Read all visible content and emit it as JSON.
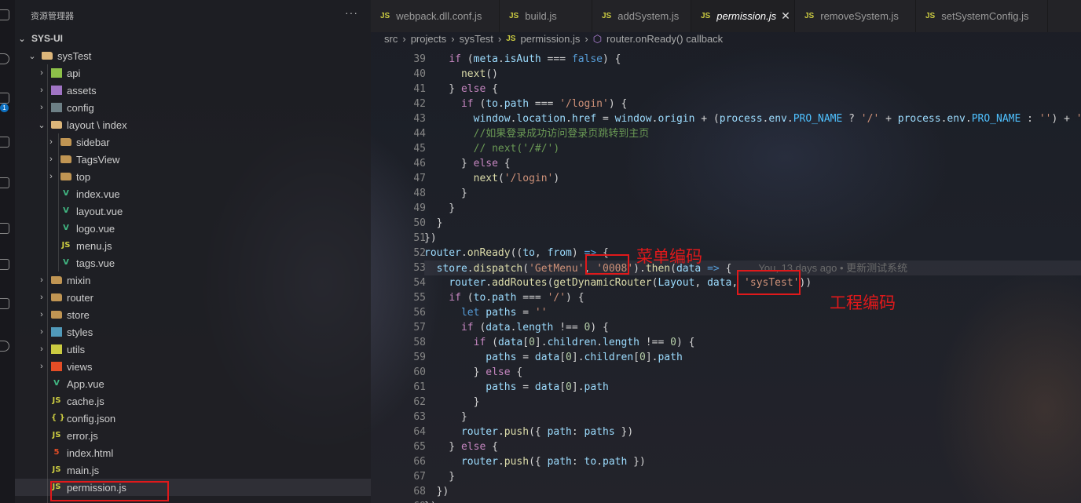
{
  "explorer": {
    "title": "资源管理器",
    "more": "···",
    "root": "SYS-UI",
    "tree": [
      {
        "label": "sysTest",
        "kind": "folder-open",
        "depth": 1,
        "chev": "⌄"
      },
      {
        "label": "api",
        "kind": "api",
        "depth": 2,
        "chev": "›"
      },
      {
        "label": "assets",
        "kind": "assets",
        "depth": 2,
        "chev": "›"
      },
      {
        "label": "config",
        "kind": "config",
        "depth": 2,
        "chev": "›"
      },
      {
        "label": "layout \\ index",
        "kind": "folder-open",
        "depth": 2,
        "chev": "⌄"
      },
      {
        "label": "sidebar",
        "kind": "folder",
        "depth": 3,
        "chev": "›"
      },
      {
        "label": "TagsView",
        "kind": "folder",
        "depth": 3,
        "chev": "›"
      },
      {
        "label": "top",
        "kind": "folder",
        "depth": 3,
        "chev": "›"
      },
      {
        "label": "index.vue",
        "kind": "vue",
        "depth": 3,
        "chev": ""
      },
      {
        "label": "layout.vue",
        "kind": "vue",
        "depth": 3,
        "chev": ""
      },
      {
        "label": "logo.vue",
        "kind": "vue",
        "depth": 3,
        "chev": ""
      },
      {
        "label": "menu.js",
        "kind": "js",
        "depth": 3,
        "chev": ""
      },
      {
        "label": "tags.vue",
        "kind": "vue",
        "depth": 3,
        "chev": ""
      },
      {
        "label": "mixin",
        "kind": "folder",
        "depth": 2,
        "chev": "›"
      },
      {
        "label": "router",
        "kind": "folder",
        "depth": 2,
        "chev": "›"
      },
      {
        "label": "store",
        "kind": "folder",
        "depth": 2,
        "chev": "›"
      },
      {
        "label": "styles",
        "kind": "styles",
        "depth": 2,
        "chev": "›"
      },
      {
        "label": "utils",
        "kind": "utils",
        "depth": 2,
        "chev": "›"
      },
      {
        "label": "views",
        "kind": "views",
        "depth": 2,
        "chev": "›"
      },
      {
        "label": "App.vue",
        "kind": "vue",
        "depth": 2,
        "chev": ""
      },
      {
        "label": "cache.js",
        "kind": "js",
        "depth": 2,
        "chev": ""
      },
      {
        "label": "config.json",
        "kind": "json",
        "depth": 2,
        "chev": ""
      },
      {
        "label": "error.js",
        "kind": "js",
        "depth": 2,
        "chev": ""
      },
      {
        "label": "index.html",
        "kind": "html",
        "depth": 2,
        "chev": ""
      },
      {
        "label": "main.js",
        "kind": "js",
        "depth": 2,
        "chev": ""
      },
      {
        "label": "permission.js",
        "kind": "js",
        "depth": 2,
        "chev": "",
        "selected": true
      }
    ]
  },
  "tabs": [
    {
      "label": "webpack.dll.conf.js",
      "active": false
    },
    {
      "label": "build.js",
      "active": false
    },
    {
      "label": "addSystem.js",
      "active": false
    },
    {
      "label": "permission.js",
      "active": true
    },
    {
      "label": "removeSystem.js",
      "active": false
    },
    {
      "label": "setSystemConfig.js",
      "active": false
    }
  ],
  "breadcrumb": {
    "parts": [
      "src",
      "projects",
      "sysTest"
    ],
    "file": "permission.js",
    "symbol": "router.onReady() callback"
  },
  "code": {
    "first_line": 39,
    "highlight_line": 53,
    "blame": "You, 13 days ago • 更新测试系统",
    "lines": [
      [
        [
          "    ",
          ""
        ],
        [
          "if",
          "kw"
        ],
        [
          " (",
          ""
        ],
        [
          "meta",
          "v"
        ],
        [
          ".",
          ""
        ],
        [
          "isAuth",
          "v"
        ],
        [
          " === ",
          ""
        ],
        [
          "false",
          "k2"
        ],
        [
          ") {",
          ""
        ]
      ],
      [
        [
          "      ",
          ""
        ],
        [
          "next",
          "f"
        ],
        [
          "()",
          ""
        ]
      ],
      [
        [
          "    } ",
          ""
        ],
        [
          "else",
          "kw"
        ],
        [
          " {",
          ""
        ]
      ],
      [
        [
          "      ",
          ""
        ],
        [
          "if",
          "kw"
        ],
        [
          " (",
          ""
        ],
        [
          "to",
          "v"
        ],
        [
          ".",
          ""
        ],
        [
          "path",
          "v"
        ],
        [
          " === ",
          ""
        ],
        [
          "'/login'",
          "s"
        ],
        [
          ") {",
          ""
        ]
      ],
      [
        [
          "        ",
          ""
        ],
        [
          "window",
          "v"
        ],
        [
          ".",
          ""
        ],
        [
          "location",
          "v"
        ],
        [
          ".",
          ""
        ],
        [
          "href",
          "v"
        ],
        [
          " = ",
          ""
        ],
        [
          "window",
          "v"
        ],
        [
          ".",
          ""
        ],
        [
          "origin",
          "v"
        ],
        [
          " + (",
          ""
        ],
        [
          "process",
          "v"
        ],
        [
          ".",
          ""
        ],
        [
          "env",
          "v"
        ],
        [
          ".",
          ""
        ],
        [
          "PRO_NAME",
          "cst"
        ],
        [
          " ? ",
          ""
        ],
        [
          "'/'",
          "s"
        ],
        [
          " + ",
          ""
        ],
        [
          "process",
          "v"
        ],
        [
          ".",
          ""
        ],
        [
          "env",
          "v"
        ],
        [
          ".",
          ""
        ],
        [
          "PRO_NAME",
          "cst"
        ],
        [
          " : ",
          ""
        ],
        [
          "''",
          "s"
        ],
        [
          ") + ",
          ""
        ],
        [
          "'/#/login'",
          "s"
        ]
      ],
      [
        [
          "        ",
          ""
        ],
        [
          "//如果登录成功访问登录页跳转到主页",
          "c"
        ]
      ],
      [
        [
          "        ",
          ""
        ],
        [
          "// next('/#/')",
          "c"
        ]
      ],
      [
        [
          "      } ",
          ""
        ],
        [
          "else",
          "kw"
        ],
        [
          " {",
          ""
        ]
      ],
      [
        [
          "        ",
          ""
        ],
        [
          "next",
          "f"
        ],
        [
          "(",
          ""
        ],
        [
          "'/login'",
          "s"
        ],
        [
          ")",
          ""
        ]
      ],
      [
        [
          "      }",
          ""
        ]
      ],
      [
        [
          "    }",
          ""
        ]
      ],
      [
        [
          "  }",
          ""
        ]
      ],
      [
        [
          "})",
          ""
        ]
      ],
      [
        [
          "router",
          "v"
        ],
        [
          ".",
          ""
        ],
        [
          "onReady",
          "f"
        ],
        [
          "((",
          ""
        ],
        [
          "to",
          "v"
        ],
        [
          ", ",
          ""
        ],
        [
          "from",
          "v"
        ],
        [
          ") ",
          ""
        ],
        [
          "=>",
          "k2"
        ],
        [
          " {",
          ""
        ]
      ],
      [
        [
          "  ",
          ""
        ],
        [
          "store",
          "v"
        ],
        [
          ".",
          ""
        ],
        [
          "dispatch",
          "f"
        ],
        [
          "(",
          ""
        ],
        [
          "'GetMenu'",
          "s"
        ],
        [
          ", ",
          ""
        ],
        [
          "'0008'",
          "s"
        ],
        [
          ").",
          ""
        ],
        [
          "then",
          "f"
        ],
        [
          "(",
          ""
        ],
        [
          "data",
          "v"
        ],
        [
          " ",
          ""
        ],
        [
          "=>",
          "k2"
        ],
        [
          " {",
          ""
        ]
      ],
      [
        [
          "    ",
          ""
        ],
        [
          "router",
          "v"
        ],
        [
          ".",
          ""
        ],
        [
          "addRoutes",
          "f"
        ],
        [
          "(",
          ""
        ],
        [
          "getDynamicRouter",
          "f"
        ],
        [
          "(",
          ""
        ],
        [
          "Layout",
          "v"
        ],
        [
          ", ",
          ""
        ],
        [
          "data",
          "v"
        ],
        [
          ", ",
          ""
        ],
        [
          "'sysTest'",
          "s"
        ],
        [
          "))",
          ""
        ]
      ],
      [
        [
          "    ",
          ""
        ],
        [
          "if",
          "kw"
        ],
        [
          " (",
          ""
        ],
        [
          "to",
          "v"
        ],
        [
          ".",
          ""
        ],
        [
          "path",
          "v"
        ],
        [
          " === ",
          ""
        ],
        [
          "'/'",
          "s"
        ],
        [
          ") {",
          ""
        ]
      ],
      [
        [
          "      ",
          ""
        ],
        [
          "let",
          "k2"
        ],
        [
          " ",
          ""
        ],
        [
          "paths",
          "v"
        ],
        [
          " = ",
          ""
        ],
        [
          "''",
          "s"
        ]
      ],
      [
        [
          "      ",
          ""
        ],
        [
          "if",
          "kw"
        ],
        [
          " (",
          ""
        ],
        [
          "data",
          "v"
        ],
        [
          ".",
          ""
        ],
        [
          "length",
          "v"
        ],
        [
          " !== ",
          ""
        ],
        [
          "0",
          "n"
        ],
        [
          ") {",
          ""
        ]
      ],
      [
        [
          "        ",
          ""
        ],
        [
          "if",
          "kw"
        ],
        [
          " (",
          ""
        ],
        [
          "data",
          "v"
        ],
        [
          "[",
          ""
        ],
        [
          "0",
          "n"
        ],
        [
          "].",
          ""
        ],
        [
          "children",
          "v"
        ],
        [
          ".",
          ""
        ],
        [
          "length",
          "v"
        ],
        [
          " !== ",
          ""
        ],
        [
          "0",
          "n"
        ],
        [
          ") {",
          ""
        ]
      ],
      [
        [
          "          ",
          ""
        ],
        [
          "paths",
          "v"
        ],
        [
          " = ",
          ""
        ],
        [
          "data",
          "v"
        ],
        [
          "[",
          ""
        ],
        [
          "0",
          "n"
        ],
        [
          "].",
          ""
        ],
        [
          "children",
          "v"
        ],
        [
          "[",
          ""
        ],
        [
          "0",
          "n"
        ],
        [
          "].",
          ""
        ],
        [
          "path",
          "v"
        ]
      ],
      [
        [
          "        } ",
          ""
        ],
        [
          "else",
          "kw"
        ],
        [
          " {",
          ""
        ]
      ],
      [
        [
          "          ",
          ""
        ],
        [
          "paths",
          "v"
        ],
        [
          " = ",
          ""
        ],
        [
          "data",
          "v"
        ],
        [
          "[",
          ""
        ],
        [
          "0",
          "n"
        ],
        [
          "].",
          ""
        ],
        [
          "path",
          "v"
        ]
      ],
      [
        [
          "        }",
          ""
        ]
      ],
      [
        [
          "      }",
          ""
        ]
      ],
      [
        [
          "      ",
          ""
        ],
        [
          "router",
          "v"
        ],
        [
          ".",
          ""
        ],
        [
          "push",
          "f"
        ],
        [
          "({ ",
          ""
        ],
        [
          "path",
          "v"
        ],
        [
          ": ",
          ""
        ],
        [
          "paths",
          "v"
        ],
        [
          " })",
          ""
        ]
      ],
      [
        [
          "    } ",
          ""
        ],
        [
          "else",
          "kw"
        ],
        [
          " {",
          ""
        ]
      ],
      [
        [
          "      ",
          ""
        ],
        [
          "router",
          "v"
        ],
        [
          ".",
          ""
        ],
        [
          "push",
          "f"
        ],
        [
          "({ ",
          ""
        ],
        [
          "path",
          "v"
        ],
        [
          ": ",
          ""
        ],
        [
          "to",
          "v"
        ],
        [
          ".",
          ""
        ],
        [
          "path",
          "v"
        ],
        [
          " })",
          ""
        ]
      ],
      [
        [
          "    }",
          ""
        ]
      ],
      [
        [
          "  })",
          ""
        ]
      ],
      [
        [
          "})",
          ""
        ]
      ]
    ]
  },
  "annotations": {
    "menu_code": "菜单编码",
    "project_code": "工程编码"
  }
}
